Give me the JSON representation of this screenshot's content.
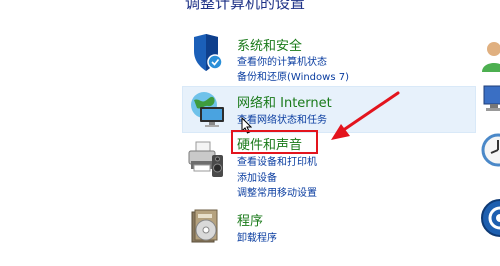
{
  "page": {
    "heading": "调整计算机的设置"
  },
  "categories": [
    {
      "title": "系统和安全",
      "links": [
        "查看你的计算机状态",
        "备份和还原(Windows 7)"
      ]
    },
    {
      "title": "网络和 Internet",
      "links": [
        "查看网络状态和任务"
      ]
    },
    {
      "title": "硬件和声音",
      "links": [
        "查看设备和打印机",
        "添加设备",
        "调整常用移动设置"
      ]
    },
    {
      "title": "程序",
      "links": [
        "卸载程序"
      ]
    }
  ],
  "colors": {
    "category_title": "#1a7a1a",
    "link": "#0a3da0",
    "hover_background": "#e7f1fb",
    "annotation": "#e3141d"
  }
}
